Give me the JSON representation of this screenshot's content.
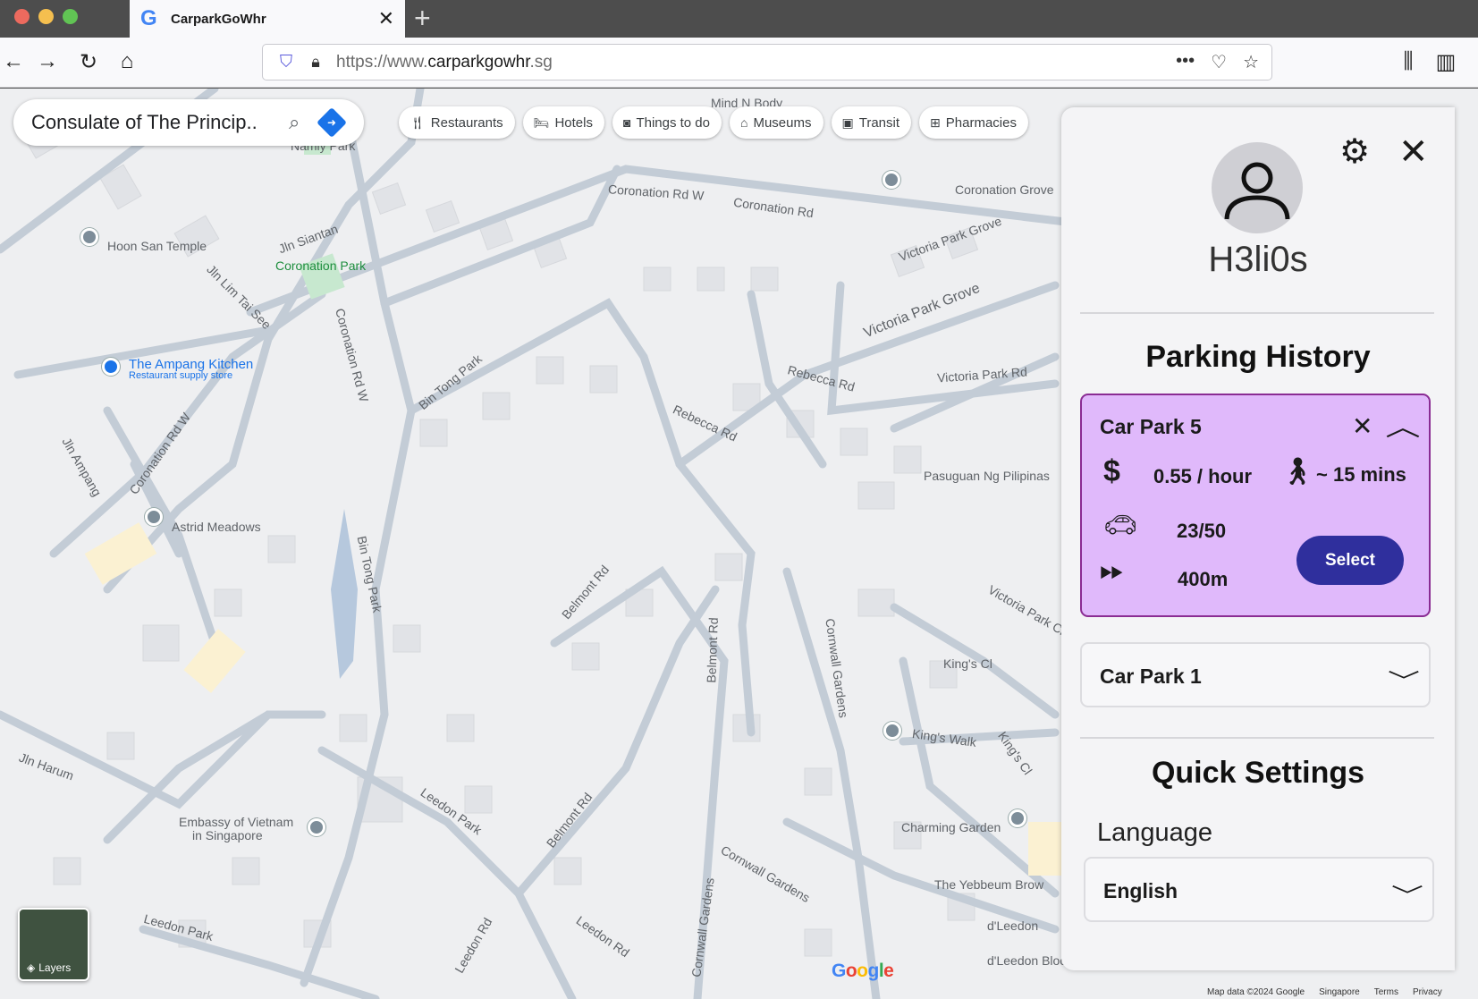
{
  "browser": {
    "tab_title": "CarparkGoWhr",
    "url_prefix": "https://www.",
    "url_domain": "carparkgowhr",
    "url_suffix": ".sg"
  },
  "map": {
    "search_value": "Consulate of The Princip..",
    "chips": [
      {
        "label": "Restaurants",
        "icon": "fork-knife-icon"
      },
      {
        "label": "Hotels",
        "icon": "bed-icon"
      },
      {
        "label": "Things to do",
        "icon": "camera-icon"
      },
      {
        "label": "Museums",
        "icon": "museum-icon"
      },
      {
        "label": "Transit",
        "icon": "train-icon"
      },
      {
        "label": "Pharmacies",
        "icon": "pharmacy-icon"
      }
    ],
    "layers_label": "Layers",
    "google_logo": "Google",
    "footer": [
      "Map data ©2024 Google",
      "Singapore",
      "Terms",
      "Privacy"
    ],
    "labels": {
      "coronation_grove": "Coronation Grove",
      "coronation_rd_w": "Coronation Rd W",
      "coronation_rd": "Coronation Rd",
      "hoon_san_temple": "Hoon San Temple",
      "jln_siantan": "Jln Siantan",
      "coronation_park": "Coronation Park",
      "victoria_park_grove": "Victoria Park Grove",
      "jln_lim_tai_see": "Jln Lim Tai See",
      "ampang_kitchen": "The Ampang Kitchen",
      "ampang_sub": "Restaurant supply store",
      "bin_tong_park": "Bin Tong Park",
      "rebecca_rd": "Rebecca Rd",
      "victoria_park_rd": "Victoria Park Rd",
      "pasuguan": "Pasuguan Ng Pilipinas",
      "astrid_meadows": "Astrid Meadows",
      "jln_ampang": "Jln Ampang",
      "belmont_rd": "Belmont Rd",
      "cornwall_gardens": "Cornwall Gardens",
      "kings_cl": "King's Cl",
      "kings_walk": "King's Walk",
      "victoria_park_cl": "Victoria Park Cl",
      "jln_harum": "Jln Harum",
      "leedon_park": "Leedon Park",
      "leedon_rd": "Leedon Rd",
      "embassy_vietnam": "Embassy of Vietnam",
      "embassy_vietnam_2": "in Singapore",
      "charming_garden": "Charming Garden",
      "yebbeum_brow": "The Yebbeum Brow",
      "dleedon": "d'Leedon",
      "dleedon_block": "d'Leedon Block",
      "namly_park": "Namly Park",
      "mind_n_body": "Mind N Body"
    }
  },
  "panel": {
    "username": "H3li0s",
    "parking_history_title": "Parking History",
    "cards": [
      {
        "name": "Car Park 5",
        "price": "0.55 / hour",
        "walk": "~ 15 mins",
        "lots": "23/50",
        "distance": "400m",
        "select_label": "Select",
        "accent": "#e0b9fb"
      },
      {
        "name": "Car Park 1"
      }
    ],
    "quick_settings_title": "Quick Settings",
    "language_label": "Language",
    "language_value": "English"
  }
}
